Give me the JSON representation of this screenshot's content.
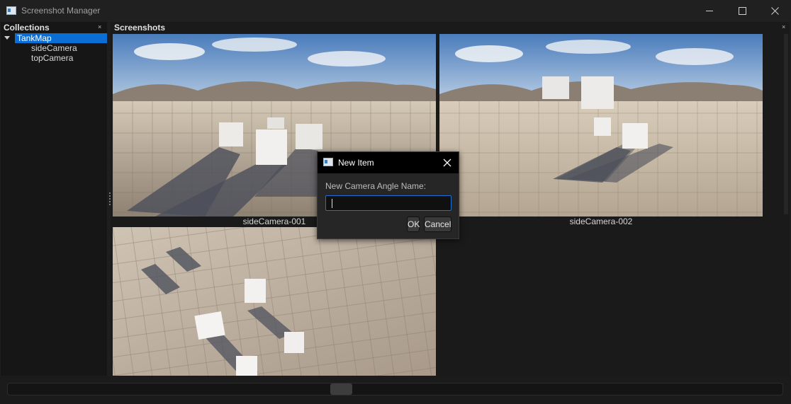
{
  "window": {
    "title": "Screenshot Manager"
  },
  "collections": {
    "header": "Collections",
    "items": [
      {
        "label": "TankMap",
        "selected": true,
        "expanded": true,
        "children": [
          {
            "label": "sideCamera"
          },
          {
            "label": "topCamera"
          }
        ]
      }
    ]
  },
  "screenshots": {
    "header": "Screenshots",
    "items": [
      {
        "caption": "sideCamera-001"
      },
      {
        "caption": "sideCamera-002"
      },
      {
        "caption": ""
      }
    ]
  },
  "dialog": {
    "title": "New Item",
    "label": "New Camera Angle Name:",
    "input_value": "",
    "ok_label": "OK",
    "cancel_label": "Cancel"
  },
  "colors": {
    "accent": "#0a6ed4",
    "background": "#1e1e1e",
    "panel": "#161616"
  },
  "icons": {
    "app": "app-window-icon",
    "minimize": "minimize-icon",
    "maximize": "maximize-icon",
    "close": "close-icon",
    "panel_close": "panel-close-icon",
    "tree_expand": "triangle-down-icon"
  }
}
